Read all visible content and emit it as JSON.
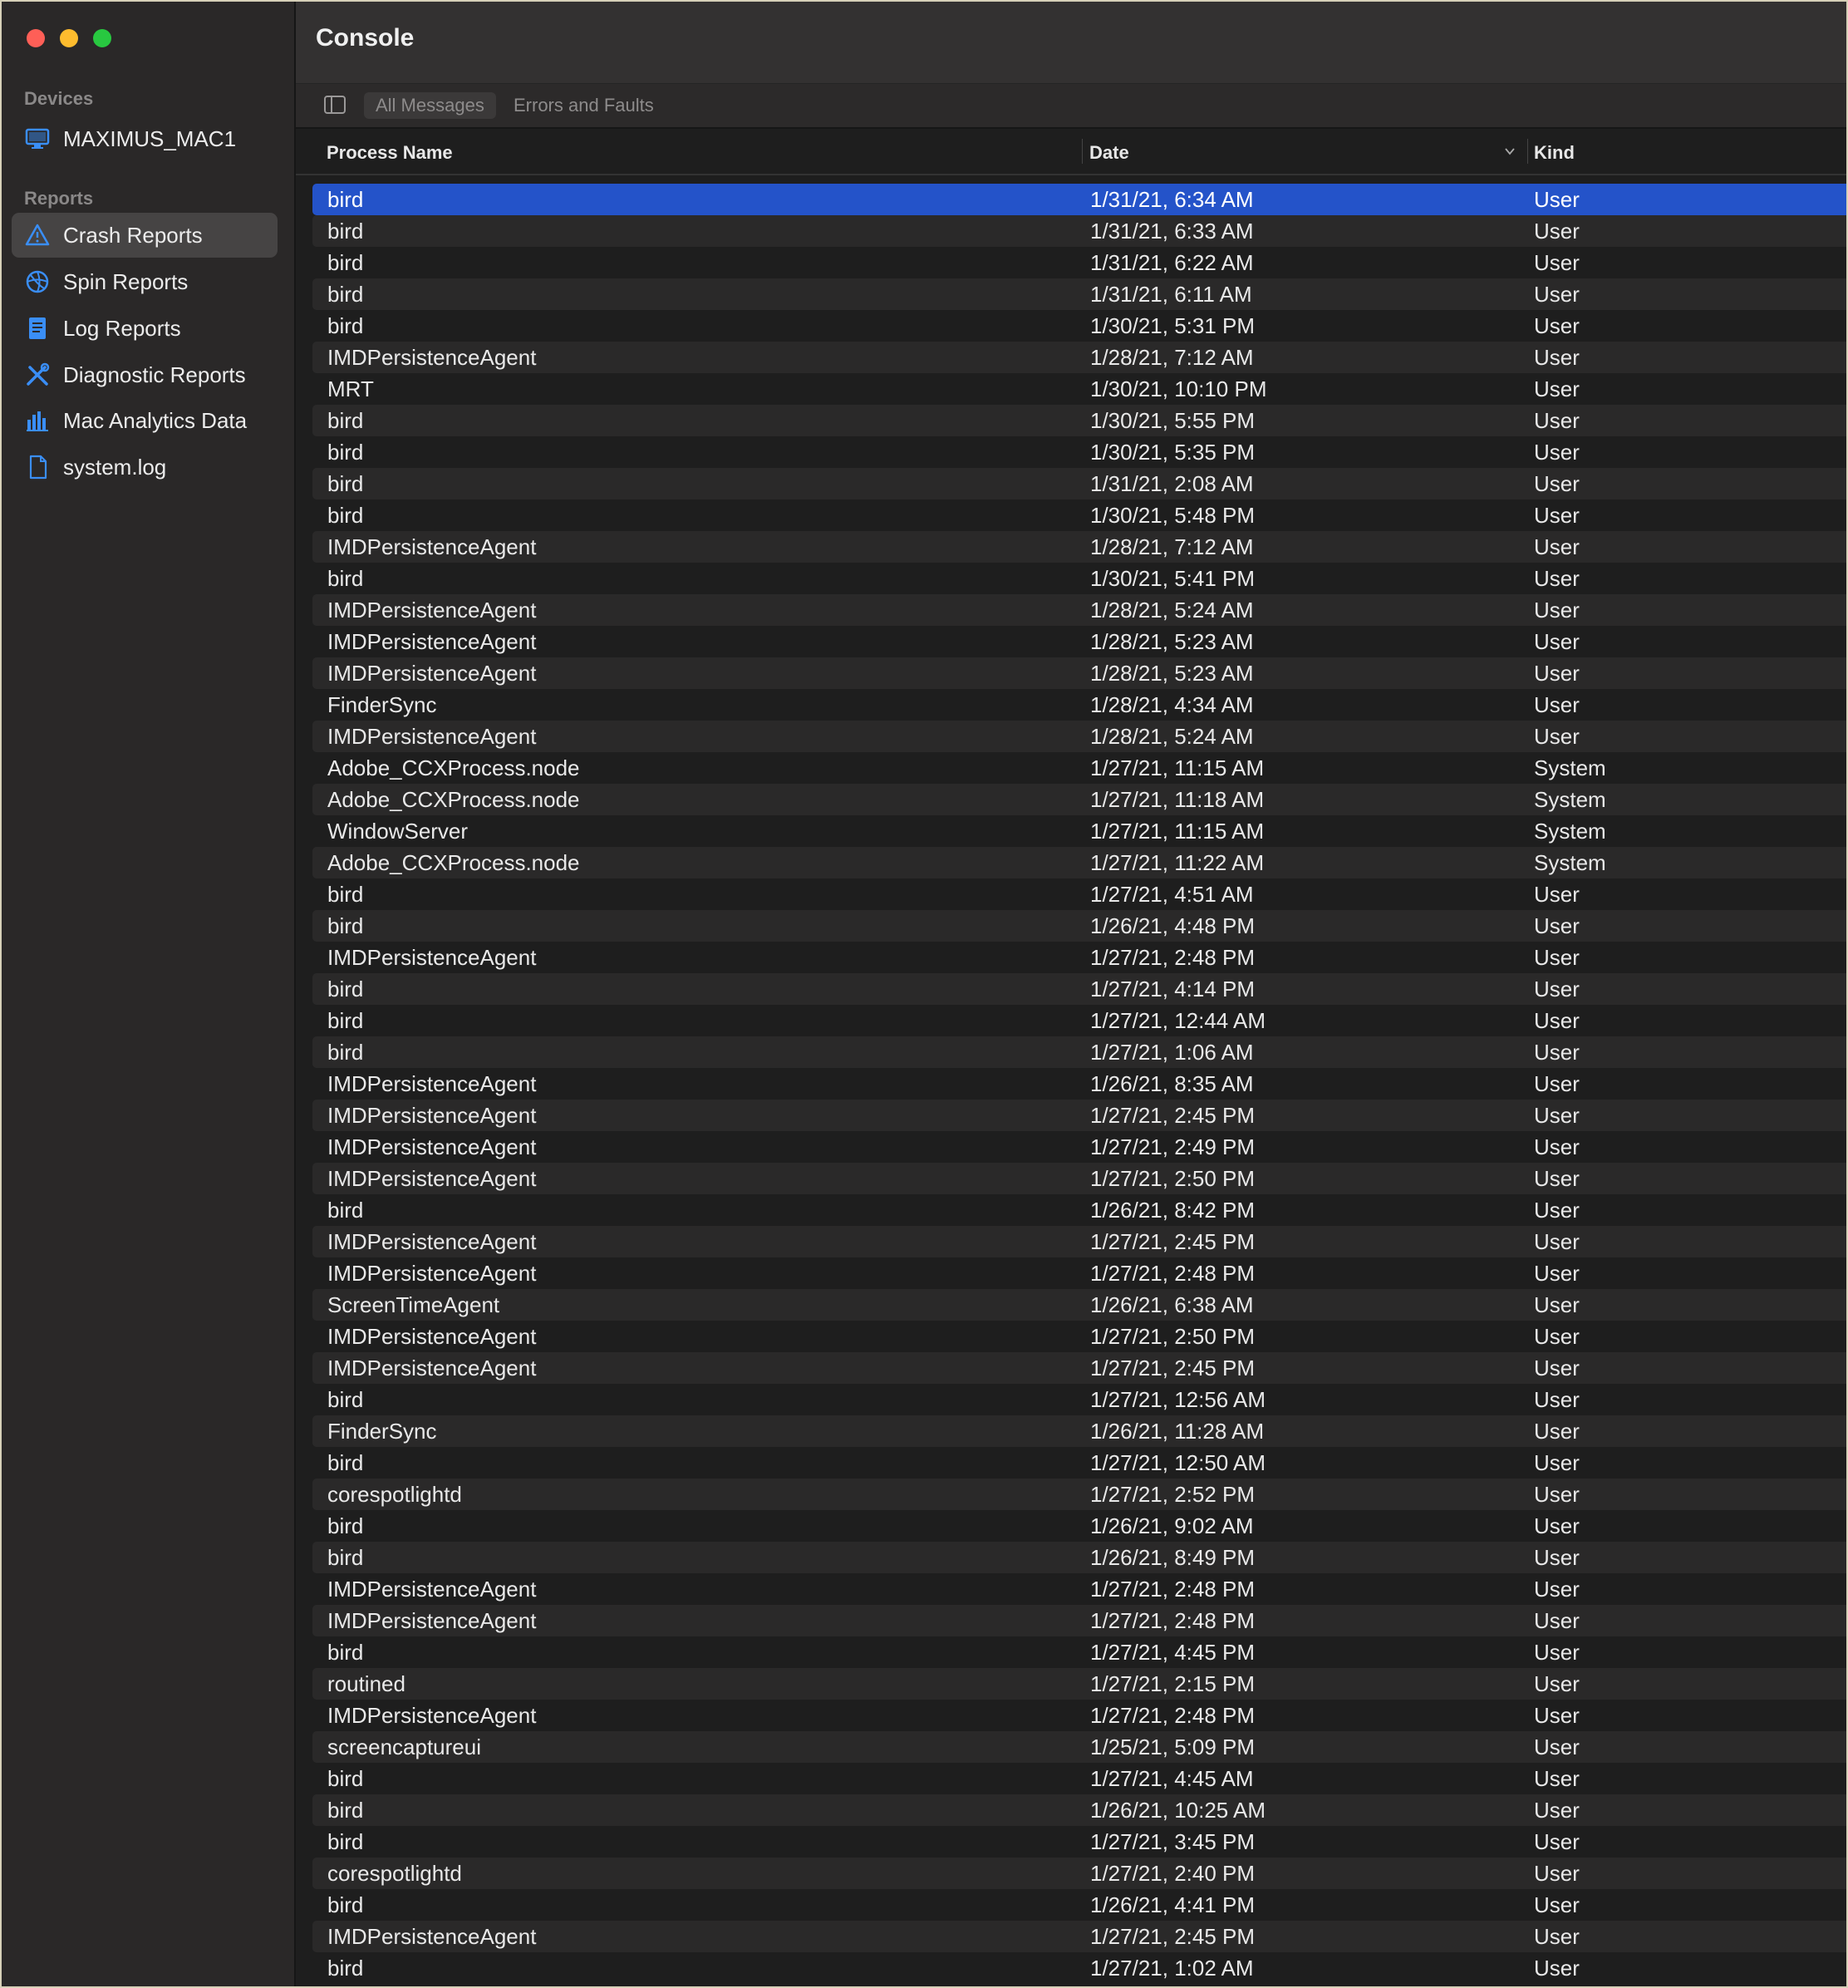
{
  "window": {
    "title": "Console"
  },
  "sidebar": {
    "devices_heading": "Devices",
    "device": "MAXIMUS_MAC1",
    "reports_heading": "Reports",
    "items": [
      {
        "label": "Crash Reports",
        "icon": "warning-triangle-icon"
      },
      {
        "label": "Spin Reports",
        "icon": "spin-icon"
      },
      {
        "label": "Log Reports",
        "icon": "document-list-icon"
      },
      {
        "label": "Diagnostic Reports",
        "icon": "tools-icon"
      },
      {
        "label": "Mac Analytics Data",
        "icon": "bar-chart-icon"
      },
      {
        "label": "system.log",
        "icon": "document-icon"
      }
    ],
    "selected_index": 0
  },
  "toolbar": {
    "all_messages": "All Messages",
    "errors_and_faults": "Errors and Faults"
  },
  "table": {
    "columns": [
      "Process Name",
      "Date",
      "Kind"
    ],
    "selected_row": 0,
    "rows": [
      [
        "bird",
        "1/31/21, 6:34 AM",
        "User"
      ],
      [
        "bird",
        "1/31/21, 6:33 AM",
        "User"
      ],
      [
        "bird",
        "1/31/21, 6:22 AM",
        "User"
      ],
      [
        "bird",
        "1/31/21, 6:11 AM",
        "User"
      ],
      [
        "bird",
        "1/30/21, 5:31 PM",
        "User"
      ],
      [
        "IMDPersistenceAgent",
        "1/28/21, 7:12 AM",
        "User"
      ],
      [
        "MRT",
        "1/30/21, 10:10 PM",
        "User"
      ],
      [
        "bird",
        "1/30/21, 5:55 PM",
        "User"
      ],
      [
        "bird",
        "1/30/21, 5:35 PM",
        "User"
      ],
      [
        "bird",
        "1/31/21, 2:08 AM",
        "User"
      ],
      [
        "bird",
        "1/30/21, 5:48 PM",
        "User"
      ],
      [
        "IMDPersistenceAgent",
        "1/28/21, 7:12 AM",
        "User"
      ],
      [
        "bird",
        "1/30/21, 5:41 PM",
        "User"
      ],
      [
        "IMDPersistenceAgent",
        "1/28/21, 5:24 AM",
        "User"
      ],
      [
        "IMDPersistenceAgent",
        "1/28/21, 5:23 AM",
        "User"
      ],
      [
        "IMDPersistenceAgent",
        "1/28/21, 5:23 AM",
        "User"
      ],
      [
        "FinderSync",
        "1/28/21, 4:34 AM",
        "User"
      ],
      [
        "IMDPersistenceAgent",
        "1/28/21, 5:24 AM",
        "User"
      ],
      [
        "Adobe_CCXProcess.node",
        "1/27/21, 11:15 AM",
        "System"
      ],
      [
        "Adobe_CCXProcess.node",
        "1/27/21, 11:18 AM",
        "System"
      ],
      [
        "WindowServer",
        "1/27/21, 11:15 AM",
        "System"
      ],
      [
        "Adobe_CCXProcess.node",
        "1/27/21, 11:22 AM",
        "System"
      ],
      [
        "bird",
        "1/27/21, 4:51 AM",
        "User"
      ],
      [
        "bird",
        "1/26/21, 4:48 PM",
        "User"
      ],
      [
        "IMDPersistenceAgent",
        "1/27/21, 2:48 PM",
        "User"
      ],
      [
        "bird",
        "1/27/21, 4:14 PM",
        "User"
      ],
      [
        "bird",
        "1/27/21, 12:44 AM",
        "User"
      ],
      [
        "bird",
        "1/27/21, 1:06 AM",
        "User"
      ],
      [
        "IMDPersistenceAgent",
        "1/26/21, 8:35 AM",
        "User"
      ],
      [
        "IMDPersistenceAgent",
        "1/27/21, 2:45 PM",
        "User"
      ],
      [
        "IMDPersistenceAgent",
        "1/27/21, 2:49 PM",
        "User"
      ],
      [
        "IMDPersistenceAgent",
        "1/27/21, 2:50 PM",
        "User"
      ],
      [
        "bird",
        "1/26/21, 8:42 PM",
        "User"
      ],
      [
        "IMDPersistenceAgent",
        "1/27/21, 2:45 PM",
        "User"
      ],
      [
        "IMDPersistenceAgent",
        "1/27/21, 2:48 PM",
        "User"
      ],
      [
        "ScreenTimeAgent",
        "1/26/21, 6:38 AM",
        "User"
      ],
      [
        "IMDPersistenceAgent",
        "1/27/21, 2:50 PM",
        "User"
      ],
      [
        "IMDPersistenceAgent",
        "1/27/21, 2:45 PM",
        "User"
      ],
      [
        "bird",
        "1/27/21, 12:56 AM",
        "User"
      ],
      [
        "FinderSync",
        "1/26/21, 11:28 AM",
        "User"
      ],
      [
        "bird",
        "1/27/21, 12:50 AM",
        "User"
      ],
      [
        "corespotlightd",
        "1/27/21, 2:52 PM",
        "User"
      ],
      [
        "bird",
        "1/26/21, 9:02 AM",
        "User"
      ],
      [
        "bird",
        "1/26/21, 8:49 PM",
        "User"
      ],
      [
        "IMDPersistenceAgent",
        "1/27/21, 2:48 PM",
        "User"
      ],
      [
        "IMDPersistenceAgent",
        "1/27/21, 2:48 PM",
        "User"
      ],
      [
        "bird",
        "1/27/21, 4:45 PM",
        "User"
      ],
      [
        "routined",
        "1/27/21, 2:15 PM",
        "User"
      ],
      [
        "IMDPersistenceAgent",
        "1/27/21, 2:48 PM",
        "User"
      ],
      [
        "screencaptureui",
        "1/25/21, 5:09 PM",
        "User"
      ],
      [
        "bird",
        "1/27/21, 4:45 AM",
        "User"
      ],
      [
        "bird",
        "1/26/21, 10:25 AM",
        "User"
      ],
      [
        "bird",
        "1/27/21, 3:45 PM",
        "User"
      ],
      [
        "corespotlightd",
        "1/27/21, 2:40 PM",
        "User"
      ],
      [
        "bird",
        "1/26/21, 4:41 PM",
        "User"
      ],
      [
        "IMDPersistenceAgent",
        "1/27/21, 2:45 PM",
        "User"
      ],
      [
        "bird",
        "1/27/21, 1:02 AM",
        "User"
      ]
    ]
  },
  "colors": {
    "accent": "#2453c9",
    "sidebar_icon": "#3a8ef6"
  }
}
